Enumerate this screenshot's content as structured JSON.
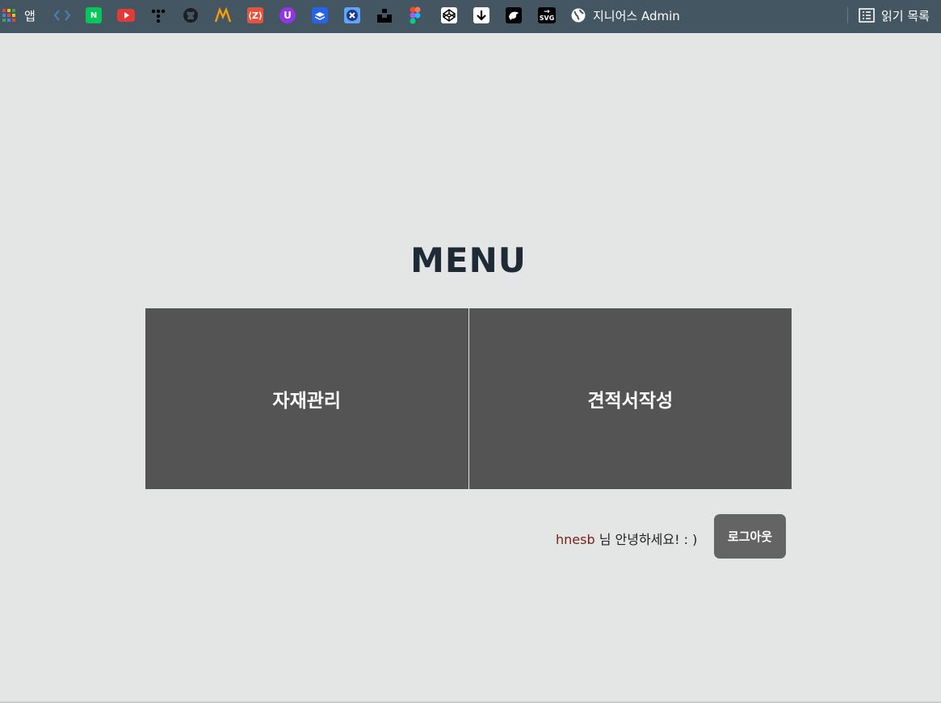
{
  "bookmarks": {
    "apps_label": "앱",
    "items": [
      {
        "icon": "code-arrows-icon",
        "color": "#3c6fb0"
      },
      {
        "icon": "naver-icon",
        "glyph": "N",
        "color": "#03c75a"
      },
      {
        "icon": "youtube-icon",
        "color": "#e53935"
      },
      {
        "icon": "dots-icon",
        "color": "#000000"
      },
      {
        "icon": "github-icon",
        "color": "#24292e"
      },
      {
        "icon": "m-logo-icon",
        "color": "#f59e0b"
      },
      {
        "icon": "zeplin-icon",
        "color": "#e5533d"
      },
      {
        "icon": "u-badge-icon",
        "color": "#9333ea"
      },
      {
        "icon": "stack-icon",
        "color": "#2563eb"
      },
      {
        "icon": "x-tool-icon",
        "color": "#3b82f6"
      },
      {
        "icon": "unsplash-icon",
        "color": "#000000"
      },
      {
        "icon": "figma-icon",
        "color": "#a259ff"
      },
      {
        "icon": "codepen-icon",
        "color": "#ffffff"
      },
      {
        "icon": "download-icon",
        "color": "#ffffff"
      },
      {
        "icon": "bird-icon",
        "color": "#000000"
      },
      {
        "icon": "svg-icon",
        "glyph": "SVG",
        "color": "#000000"
      }
    ],
    "globe_label": "지니어스 Admin",
    "reading_list_label": "읽기 목록"
  },
  "main": {
    "title": "MENU",
    "tiles": [
      "자재관리",
      "견적서작성"
    ],
    "greeting_user": "hnesb",
    "greeting_suffix": " 님 안녕하세요! : )",
    "logout_label": "로그아웃"
  },
  "colors": {
    "bar": "#445661",
    "background": "#e4e6e6",
    "tile": "#545454",
    "title": "#1e2a36",
    "username": "#7a1f12",
    "button": "#646464"
  }
}
